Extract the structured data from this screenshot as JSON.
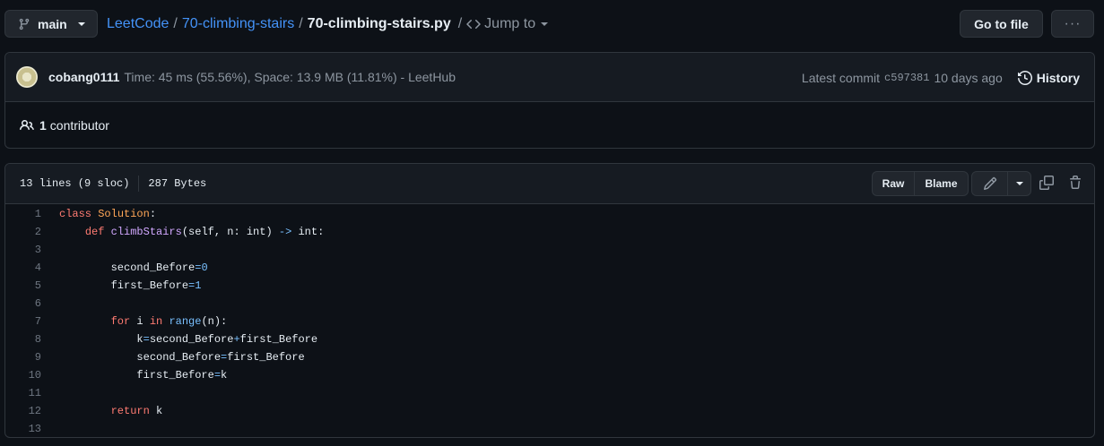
{
  "branch": {
    "label": "main",
    "icon": "git-branch-icon"
  },
  "breadcrumb": {
    "repo": "LeetCode",
    "folder": "70-climbing-stairs",
    "file": "70-climbing-stairs.py",
    "separator": "/",
    "jump_to": "Jump to",
    "jump_icon": "code-icon"
  },
  "actions": {
    "goto_file": "Go to file",
    "more": "···"
  },
  "commit": {
    "author": "cobang0111",
    "message": "Time: 45 ms (55.56%), Space: 13.9 MB (11.81%) - LeetHub",
    "latest_label": "Latest commit",
    "sha": "c597381",
    "age": "10 days ago",
    "history_label": "History",
    "history_icon": "history-icon"
  },
  "contributors": {
    "count": "1",
    "label": "contributor",
    "icon": "people-icon"
  },
  "file_info": {
    "lines": "13 lines (9 sloc)",
    "size": "287 Bytes"
  },
  "file_actions": {
    "raw": "Raw",
    "blame": "Blame",
    "edit_icon": "pencil-icon",
    "dropdown_icon": "triangle-down-icon",
    "copy_icon": "copy-icon",
    "delete_icon": "trash-icon"
  },
  "code_lines": [
    {
      "n": "1",
      "tokens": [
        [
          "kw",
          "class"
        ],
        [
          "",
          ""
        ],
        [
          "",
          " "
        ],
        [
          "cls",
          "Solution"
        ],
        [
          "",
          ":"
        ]
      ]
    },
    {
      "n": "2",
      "tokens": [
        [
          "",
          "    "
        ],
        [
          "kw",
          "def"
        ],
        [
          "",
          " "
        ],
        [
          "fn",
          "climbStairs"
        ],
        [
          "",
          "(self, n: int) "
        ],
        [
          "op",
          "->"
        ],
        [
          "",
          " int:"
        ]
      ]
    },
    {
      "n": "3",
      "tokens": []
    },
    {
      "n": "4",
      "tokens": [
        [
          "",
          "        second_Before"
        ],
        [
          "op",
          "="
        ],
        [
          "num",
          "0"
        ]
      ]
    },
    {
      "n": "5",
      "tokens": [
        [
          "",
          "        first_Before"
        ],
        [
          "op",
          "="
        ],
        [
          "num",
          "1"
        ]
      ]
    },
    {
      "n": "6",
      "tokens": []
    },
    {
      "n": "7",
      "tokens": [
        [
          "",
          "        "
        ],
        [
          "kw",
          "for"
        ],
        [
          "",
          " i "
        ],
        [
          "kw",
          "in"
        ],
        [
          "",
          " "
        ],
        [
          "bi",
          "range"
        ],
        [
          "",
          "(n):"
        ]
      ]
    },
    {
      "n": "8",
      "tokens": [
        [
          "",
          "            k"
        ],
        [
          "op",
          "="
        ],
        [
          "",
          "second_Before"
        ],
        [
          "op",
          "+"
        ],
        [
          "",
          "first_Before"
        ]
      ]
    },
    {
      "n": "9",
      "tokens": [
        [
          "",
          "            second_Before"
        ],
        [
          "op",
          "="
        ],
        [
          "",
          "first_Before"
        ]
      ]
    },
    {
      "n": "10",
      "tokens": [
        [
          "",
          "            first_Before"
        ],
        [
          "op",
          "="
        ],
        [
          "",
          "k"
        ]
      ]
    },
    {
      "n": "11",
      "tokens": []
    },
    {
      "n": "12",
      "tokens": [
        [
          "",
          "        "
        ],
        [
          "kw",
          "return"
        ],
        [
          "",
          " k"
        ]
      ]
    },
    {
      "n": "13",
      "tokens": []
    }
  ]
}
